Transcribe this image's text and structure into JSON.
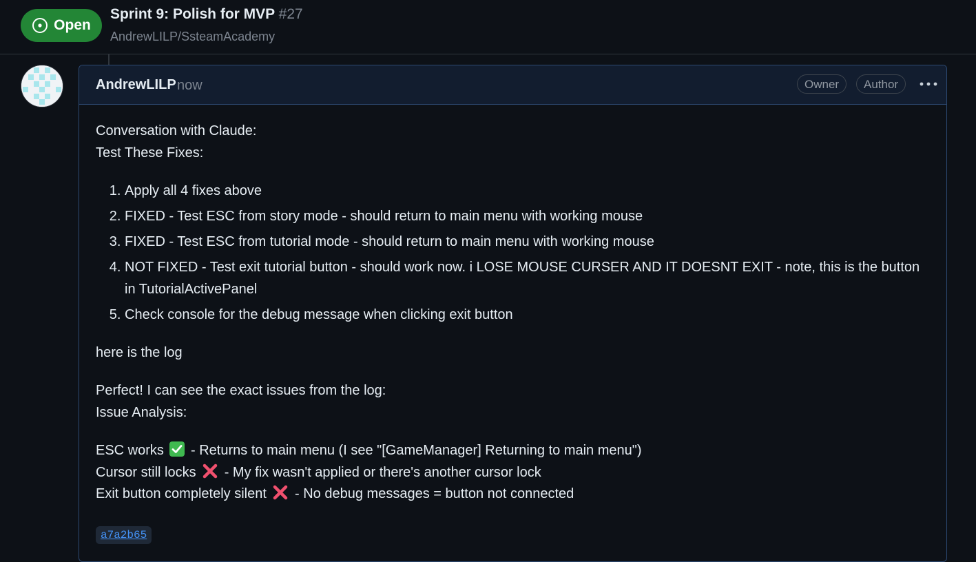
{
  "header": {
    "status_label": "Open",
    "title": "Sprint 9: Polish for MVP",
    "number": "#27",
    "repo": "AndrewLILP/SsteamAcademy"
  },
  "comment": {
    "author": "AndrewLILP",
    "timestamp": "now",
    "badges": [
      "Owner",
      "Author"
    ],
    "intro_1": "Conversation with Claude:",
    "intro_2": "Test These Fixes:",
    "list": [
      "Apply all 4 fixes above",
      "FIXED - Test ESC from story mode - should return to main menu with working mouse",
      "FIXED - Test ESC from tutorial mode - should return to main menu with working mouse",
      "NOT FIXED - Test exit tutorial button - should work now. i LOSE MOUSE CURSER AND IT DOESNT EXIT - note, this is the button in TutorialActivePanel",
      "Check console for the debug message when clicking exit button"
    ],
    "log_text": "here is the log",
    "perfect_text": "Perfect! I can see the exact issues from the log:",
    "analysis_heading": "Issue Analysis:",
    "esc_prefix": "ESC works",
    "esc_suffix": " - Returns to main menu (I see \"[GameManager] Returning to main menu\")",
    "cursor_prefix": "Cursor still locks",
    "cursor_suffix": " - My fix wasn't applied or there's another cursor lock",
    "exit_prefix": "Exit button completely silent",
    "exit_suffix": " - No debug messages = button not connected",
    "commit": "a7a2b65"
  },
  "icons": {
    "status": "circle-dot-icon",
    "more": "kebab-horizontal-icon",
    "check": "check-mark-button-emoji",
    "cross": "cross-mark-emoji"
  },
  "colors": {
    "open_green": "#238636",
    "link_blue": "#4493f8",
    "cross_red": "#f0506e"
  }
}
